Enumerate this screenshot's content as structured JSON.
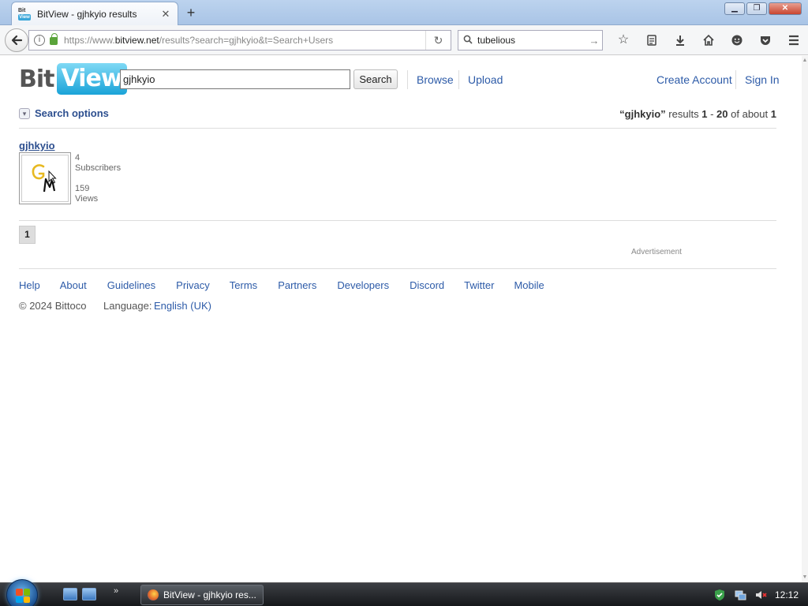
{
  "browser": {
    "tab_title": "BitView - gjhkyio results",
    "favicon_top": "Bit",
    "favicon_bottom": "View",
    "url_prefix": "https://www.",
    "url_domain": "bitview.net",
    "url_path": "/results?search=gjhkyio&t=Search+Users",
    "search_text": "tubelious"
  },
  "site": {
    "logo_bit": "Bit",
    "logo_view": "View",
    "search_value": "gjhkyio",
    "search_button": "Search",
    "nav": {
      "browse": "Browse",
      "upload": "Upload",
      "create_account": "Create Account",
      "sign_in": "Sign In"
    },
    "search_options": "Search options",
    "summary": {
      "query": "“gjhkyio”",
      "results_word": "results",
      "from": "1",
      "dash": "-",
      "to": "20",
      "of_about": "of about",
      "total": "1"
    },
    "result": {
      "name": "gjhkyio",
      "subscribers_count": "4",
      "subscribers_label": "Subscribers",
      "views_count": "159",
      "views_label": "Views"
    },
    "pager_page": "1",
    "advertisement": "Advertisement",
    "footer": {
      "links": [
        "Help",
        "About",
        "Guidelines",
        "Privacy",
        "Terms",
        "Partners",
        "Developers",
        "Discord",
        "Twitter",
        "Mobile"
      ],
      "copyright": "© 2024 Bittoco",
      "language_label": "Language:",
      "language_value": "English (UK)"
    }
  },
  "taskbar": {
    "task_label": "BitView - gjhkyio res...",
    "clock": "12:12"
  },
  "colors": {
    "link": "#2d5ba8",
    "logo_view": "#1aa3d8",
    "accent_dark": "#2d4f8f"
  }
}
